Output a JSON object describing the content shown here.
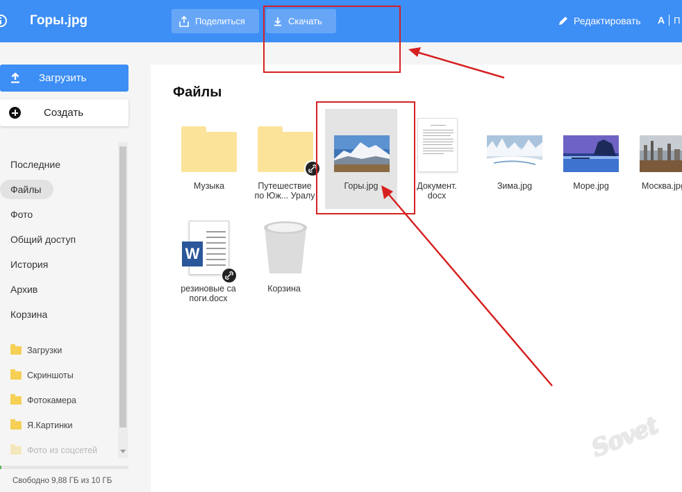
{
  "header": {
    "file_title": "Горы.jpg",
    "share_label": "Поделиться",
    "download_label": "Скачать",
    "edit_label": "Редактировать",
    "rename_label": "П"
  },
  "sidebar": {
    "upload_label": "Загрузить",
    "create_label": "Создать",
    "nav": [
      "Последние",
      "Файлы",
      "Фото",
      "Общий доступ",
      "История",
      "Архив",
      "Корзина"
    ],
    "active_nav": "Файлы",
    "folders": [
      "Загрузки",
      "Скриншоты",
      "Фотокамера",
      "Я.Картинки",
      "Фото из соцсетей"
    ],
    "quota_text": "Свободно 9,88 ГБ из 10 ГБ",
    "quota_used_fraction": 0.012
  },
  "main": {
    "title": "Файлы",
    "items": [
      {
        "name": "Музыка",
        "type": "folder"
      },
      {
        "name": "Путешествие по Юж... Уралу",
        "type": "folder",
        "shared": true
      },
      {
        "name": "Горы.jpg",
        "type": "image",
        "selected": true
      },
      {
        "name": "Документ.docx",
        "type": "doc"
      },
      {
        "name": "Зима.jpg",
        "type": "image"
      },
      {
        "name": "Море.jpg",
        "type": "image"
      },
      {
        "name": "Москва.jpg",
        "type": "image"
      },
      {
        "name": "резиновые сапоги.docx",
        "type": "word",
        "shared": true
      },
      {
        "name": "Корзина",
        "type": "trash"
      }
    ]
  },
  "labels": {
    "item0": "Музыка",
    "item1_line1": "Путешествие",
    "item1_line2": "по Юж... Уралу",
    "item2": "Горы.jpg",
    "item3_line1": "Документ.",
    "item3_line2": "docx",
    "item4": "Зима.jpg",
    "item5": "Море.jpg",
    "item6": "Москва.jpg",
    "item7_line1": "резиновые са",
    "item7_line2": "поги.docx",
    "item8": "Корзина"
  },
  "watermark": "Sovet",
  "colors": {
    "accent": "#3d8ef5",
    "annotation": "#d62020",
    "folder": "#fbe39a"
  }
}
